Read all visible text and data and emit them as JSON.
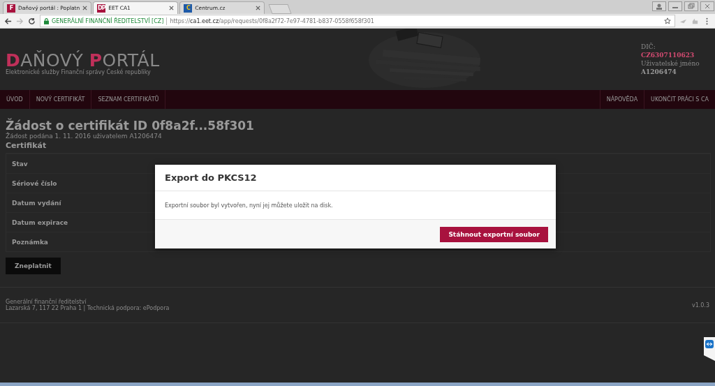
{
  "browser": {
    "tabs": [
      {
        "label": "Daňový portál : Poplatn",
        "selected": false,
        "favicon": "F"
      },
      {
        "label": "EET CA1",
        "selected": true,
        "favicon": "DP"
      },
      {
        "label": "Centrum.cz",
        "selected": false,
        "favicon": "C"
      }
    ],
    "address": {
      "site": "GENERÁLNÍ FINANČNÍ ŘEDITELSTVÍ [CZ]",
      "scheme": "https://",
      "host": "ca1.eet.cz",
      "path": "/app/requests/0f8a2f72-7e97-4781-b837-0558f658f301"
    }
  },
  "header": {
    "logo": {
      "first_initial": "D",
      "first_rest": "AŇOVÝ",
      "second_initial": "P",
      "second_rest": "ORTÁL"
    },
    "tagline": "Elektronické služby Finanční správy České republiky",
    "user": {
      "dic_label": "DIČ:",
      "dic": "CZ6307110623",
      "username_label": "Uživatelské jméno",
      "username": "A1206474"
    }
  },
  "nav": {
    "left": [
      "ÚVOD",
      "NOVÝ CERTIFIKÁT",
      "SEZNAM CERTIFIKÁTŮ"
    ],
    "right": [
      "NÁPOVĚDA",
      "UKONČIT PRÁCI S CA"
    ]
  },
  "request": {
    "title": "Žádost o certifikát ID 0f8a2f...58f301",
    "subtitle": "Žádost podána 1. 11. 2016 uživatelem A1206474",
    "section": "Certifikát",
    "fields": [
      "Stav",
      "Sériové číslo",
      "Datum vydání",
      "Datum expirace",
      "Poznámka"
    ],
    "revoke_button": "Zneplatnit"
  },
  "footer": {
    "org": "Generální finanční ředitelství",
    "address": "Lazarská 7, 117 22 Praha 1 | Technická podpora: ePodpora",
    "version": "v1.0.3"
  },
  "modal": {
    "title": "Export do PKCS12",
    "message": "Exportní soubor byl vytvořen, nyní jej můžete uložit na disk.",
    "button": "Stáhnout exportní soubor"
  }
}
